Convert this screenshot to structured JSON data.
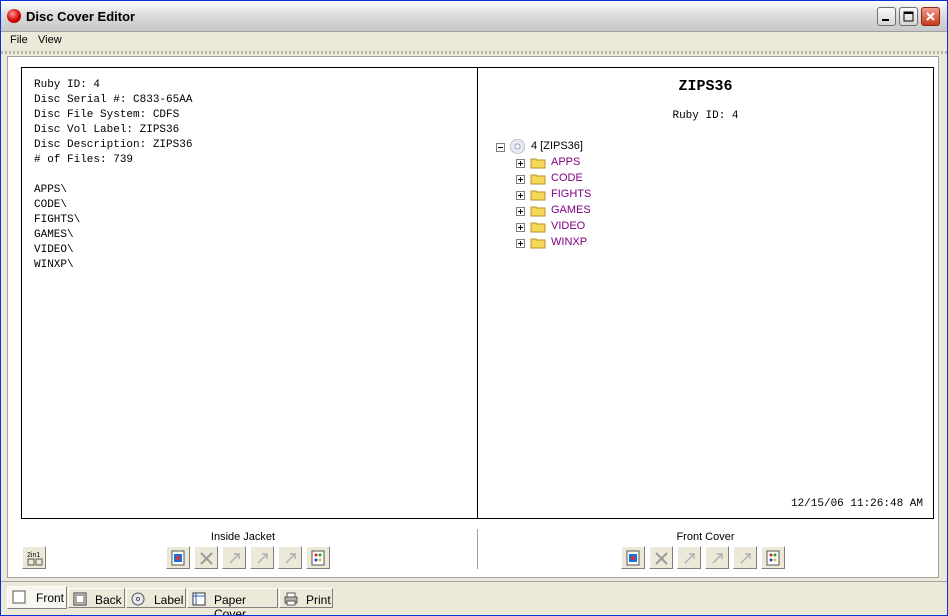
{
  "window": {
    "title": "Disc Cover Editor"
  },
  "menu": {
    "file": "File",
    "view": "View"
  },
  "inside_jacket": {
    "label": "Inside Jacket",
    "lines": [
      "Ruby ID: 4",
      "Disc Serial #: C833-65AA",
      "Disc File System: CDFS",
      "Disc Vol Label: ZIPS36",
      "Disc Description: ZIPS36",
      "# of Files: 739",
      "",
      "APPS\\",
      "CODE\\",
      "FIGHTS\\",
      "GAMES\\",
      "VIDEO\\",
      "WINXP\\"
    ]
  },
  "front_cover": {
    "label": "Front Cover",
    "title": "ZIPS36",
    "ruby_id": "Ruby ID: 4",
    "tree_root": "4 [ZIPS36]",
    "folders": [
      "APPS",
      "CODE",
      "FIGHTS",
      "GAMES",
      "VIDEO",
      "WINXP"
    ],
    "timestamp": "12/15/06 11:26:48 AM"
  },
  "toolbar": {
    "two_in_one": "2in1"
  },
  "tabs": [
    {
      "label": "Front",
      "icon": "page-icon",
      "active": true
    },
    {
      "label": "Back",
      "icon": "back-page-icon",
      "active": false
    },
    {
      "label": "Label",
      "icon": "disc-icon",
      "active": false
    },
    {
      "label": "Paper Cover",
      "icon": "paper-cover-icon",
      "active": false
    },
    {
      "label": "Print",
      "icon": "printer-icon",
      "active": false
    }
  ],
  "colors": {
    "folder_text": "#800080",
    "window_bg": "#ece9d8"
  }
}
